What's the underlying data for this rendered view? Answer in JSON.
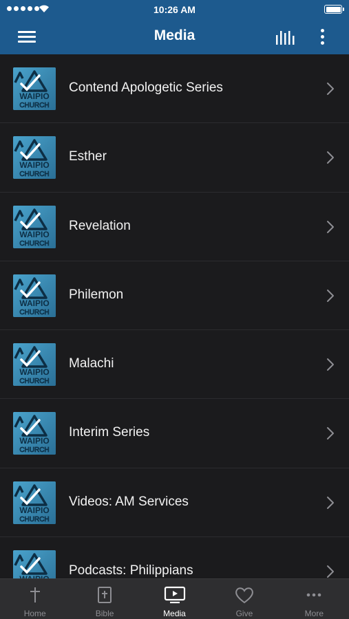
{
  "status_bar": {
    "time": "10:26 AM"
  },
  "header": {
    "title": "Media"
  },
  "media_items": [
    {
      "label": "Contend Apologetic Series"
    },
    {
      "label": "Esther"
    },
    {
      "label": "Revelation"
    },
    {
      "label": "Philemon"
    },
    {
      "label": "Malachi"
    },
    {
      "label": "Interim Series"
    },
    {
      "label": "Videos: AM Services"
    },
    {
      "label": "Podcasts: Philippians"
    }
  ],
  "thumbnail": {
    "logo_text": "WAIPIO",
    "logo_subtext": "CHURCH"
  },
  "tabs": [
    {
      "label": "Home",
      "icon": "cross-icon"
    },
    {
      "label": "Bible",
      "icon": "bible-icon"
    },
    {
      "label": "Media",
      "icon": "media-player-icon",
      "active": true
    },
    {
      "label": "Give",
      "icon": "heart-icon"
    },
    {
      "label": "More",
      "icon": "ellipsis-icon"
    }
  ],
  "colors": {
    "header": "#1d5a8e",
    "background": "#1b1b1d",
    "tab_bar": "#2e2e30",
    "thumbnail": "#3a8fb8"
  }
}
